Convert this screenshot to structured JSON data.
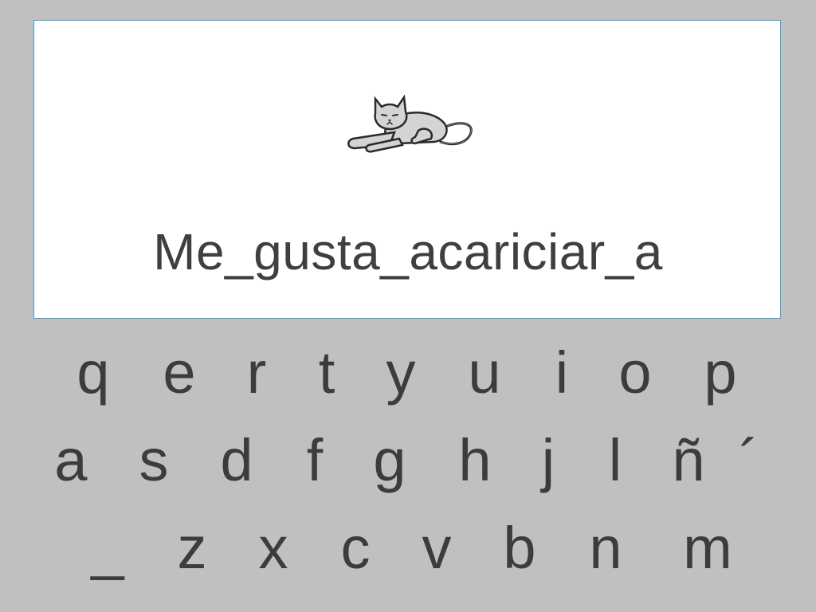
{
  "sentence": {
    "text": "Me_gusta_acariciar_a",
    "picture_icon": "cat-lying-icon"
  },
  "keyboard": {
    "row1": [
      "q",
      "e",
      "r",
      "t",
      "y",
      "u",
      "i",
      "o",
      "p"
    ],
    "row2": [
      "a",
      "s",
      "d",
      "f",
      "g",
      "h",
      "j",
      "l",
      "ñ",
      "´"
    ],
    "row3": [
      "_",
      "z",
      "x",
      "c",
      "v",
      "b",
      "n",
      "m"
    ]
  },
  "colors": {
    "background": "#c0c0c0",
    "panel": "#ffffff",
    "panel_border": "#3aa0d8",
    "text": "#3f3f3f"
  }
}
